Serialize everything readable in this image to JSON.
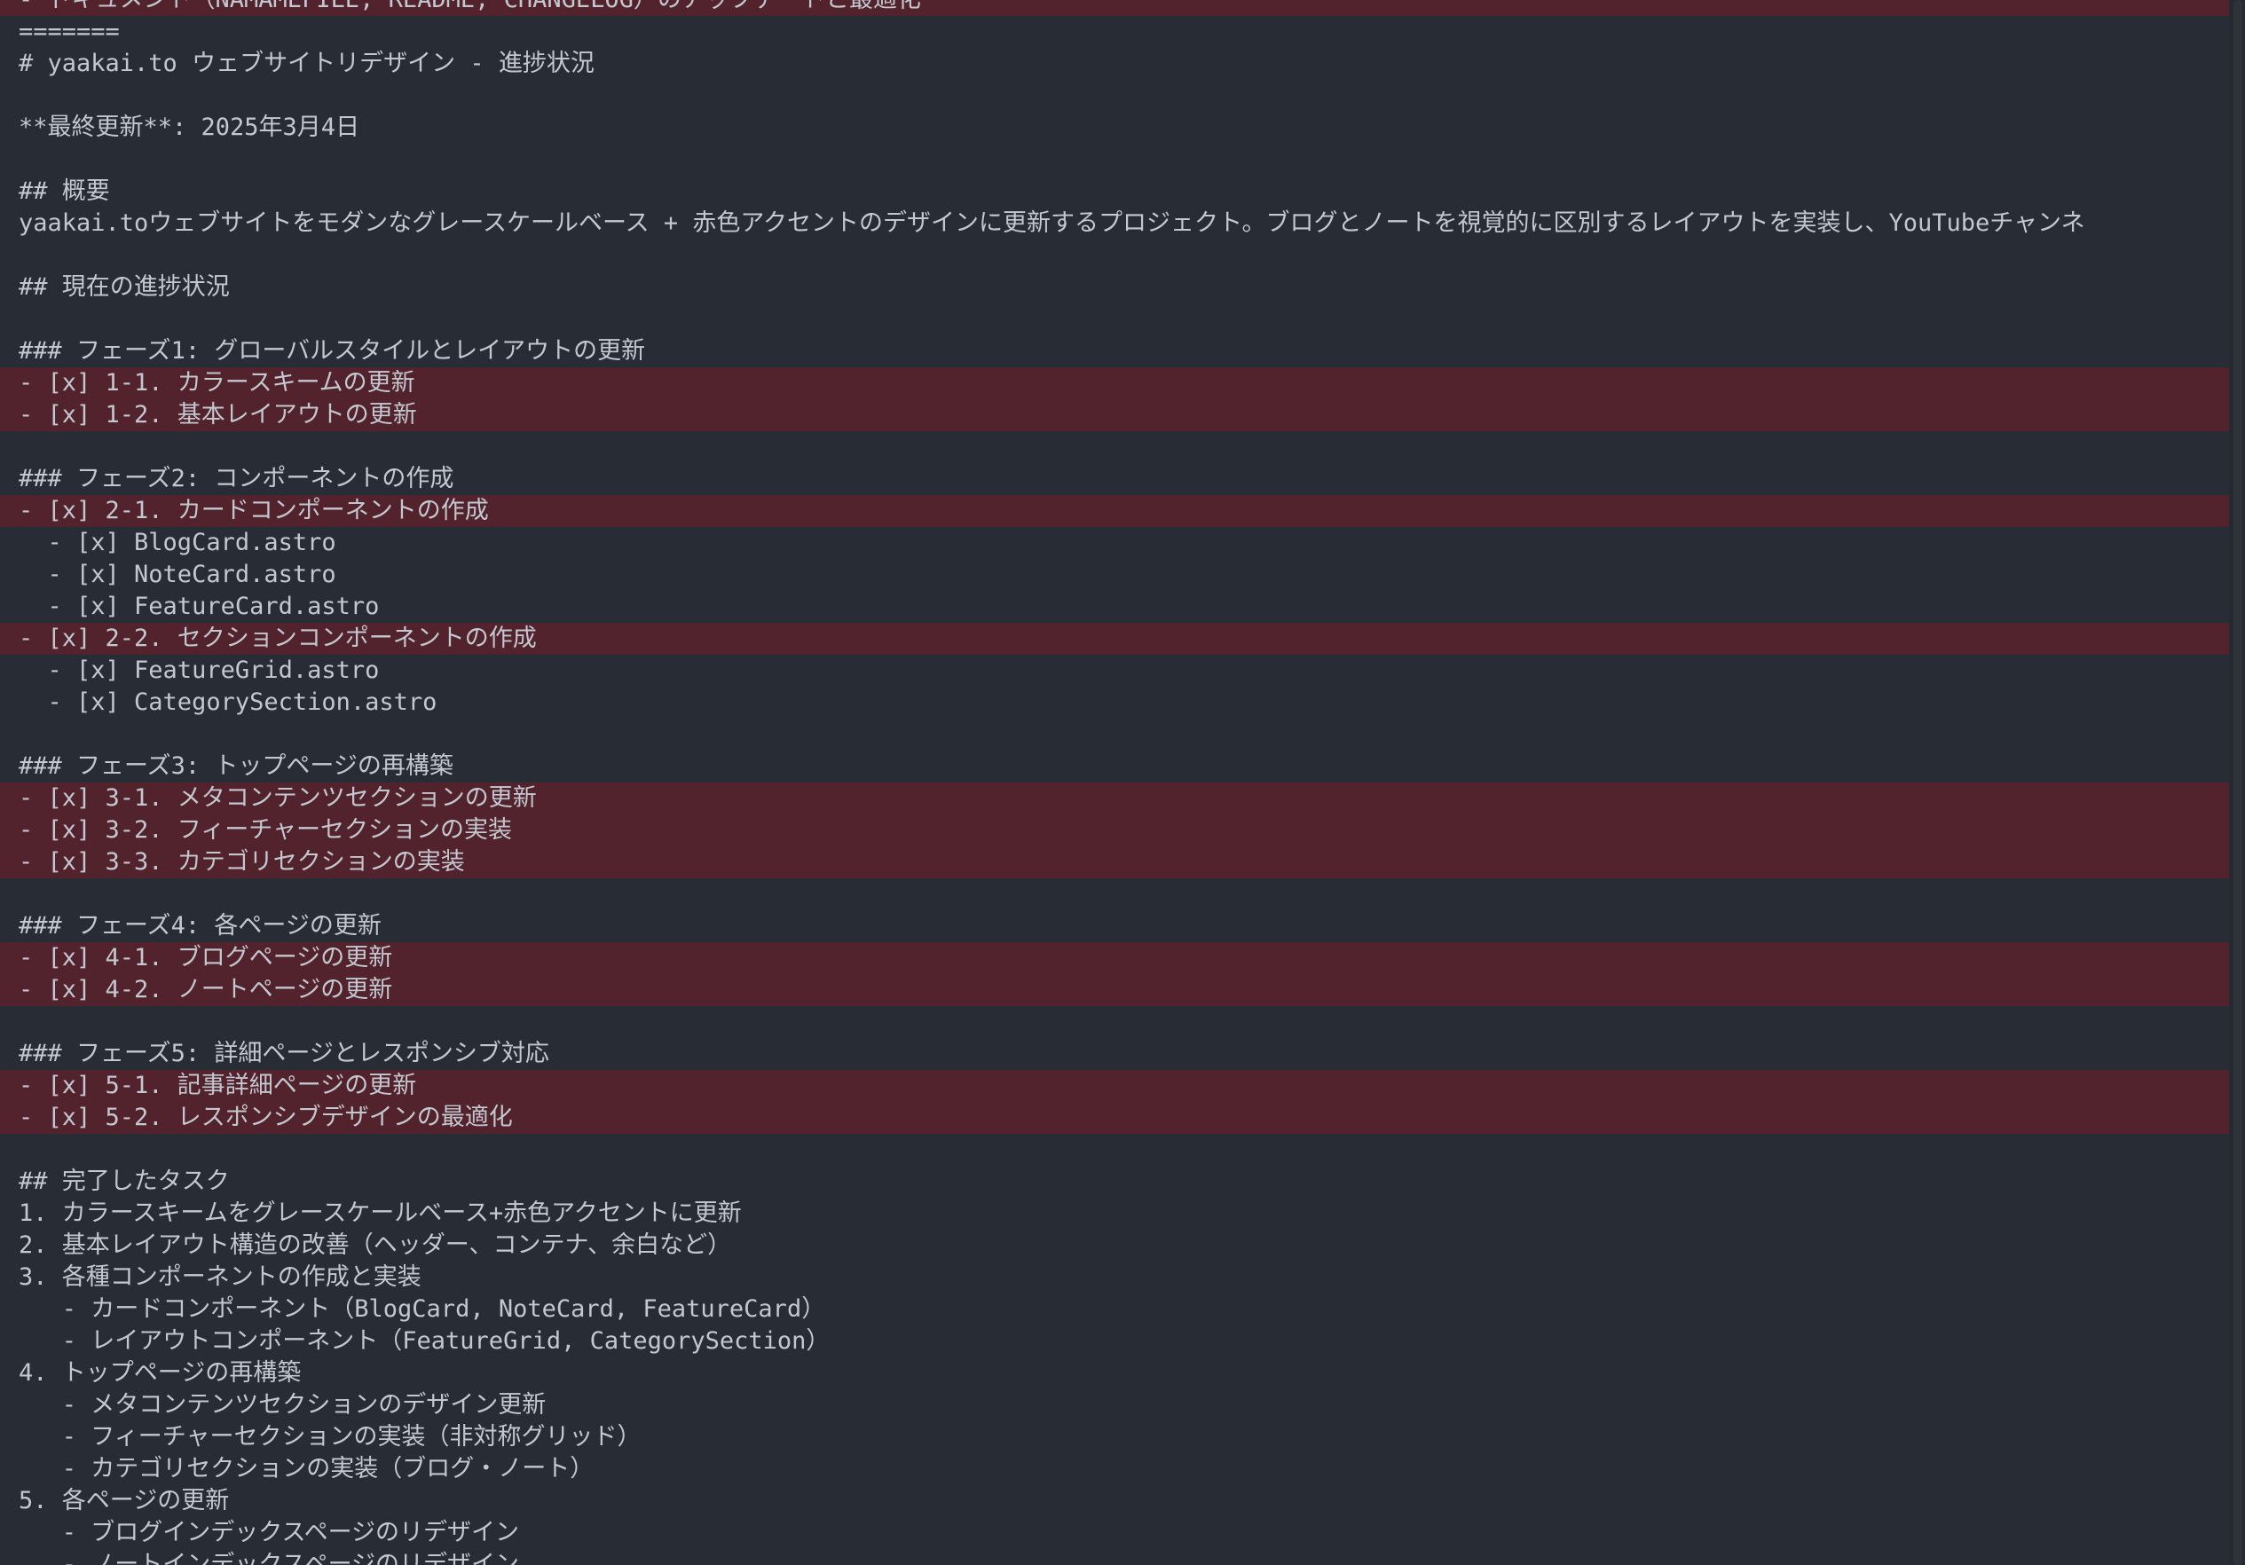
{
  "document": {
    "lines": [
      {
        "text": "- ドキュメント（NAMAMEFILE, README, CHANGELOG）のアップデートと最適化",
        "highlight": true
      },
      {
        "text": "=======",
        "highlight": false
      },
      {
        "text": "# yaakai.to ウェブサイトリデザイン - 進捗状況",
        "highlight": false
      },
      {
        "text": "",
        "highlight": false
      },
      {
        "text": "**最終更新**: 2025年3月4日",
        "highlight": false
      },
      {
        "text": "",
        "highlight": false
      },
      {
        "text": "## 概要",
        "highlight": false
      },
      {
        "text": "yaakai.toウェブサイトをモダンなグレースケールベース + 赤色アクセントのデザインに更新するプロジェクト。ブログとノートを視覚的に区別するレイアウトを実装し、YouTubeチャンネ",
        "highlight": false
      },
      {
        "text": "",
        "highlight": false
      },
      {
        "text": "## 現在の進捗状況",
        "highlight": false
      },
      {
        "text": "",
        "highlight": false
      },
      {
        "text": "### フェーズ1: グローバルスタイルとレイアウトの更新",
        "highlight": false
      },
      {
        "text": "- [x] 1-1. カラースキームの更新",
        "highlight": true
      },
      {
        "text": "- [x] 1-2. 基本レイアウトの更新",
        "highlight": true
      },
      {
        "text": "",
        "highlight": false
      },
      {
        "text": "### フェーズ2: コンポーネントの作成",
        "highlight": false
      },
      {
        "text": "- [x] 2-1. カードコンポーネントの作成",
        "highlight": true
      },
      {
        "text": "  - [x] BlogCard.astro",
        "highlight": false
      },
      {
        "text": "  - [x] NoteCard.astro",
        "highlight": false
      },
      {
        "text": "  - [x] FeatureCard.astro",
        "highlight": false
      },
      {
        "text": "- [x] 2-2. セクションコンポーネントの作成",
        "highlight": true
      },
      {
        "text": "  - [x] FeatureGrid.astro",
        "highlight": false
      },
      {
        "text": "  - [x] CategorySection.astro",
        "highlight": false
      },
      {
        "text": "",
        "highlight": false
      },
      {
        "text": "### フェーズ3: トップページの再構築",
        "highlight": false
      },
      {
        "text": "- [x] 3-1. メタコンテンツセクションの更新",
        "highlight": true
      },
      {
        "text": "- [x] 3-2. フィーチャーセクションの実装",
        "highlight": true
      },
      {
        "text": "- [x] 3-3. カテゴリセクションの実装",
        "highlight": true
      },
      {
        "text": "",
        "highlight": false
      },
      {
        "text": "### フェーズ4: 各ページの更新",
        "highlight": false
      },
      {
        "text": "- [x] 4-1. ブログページの更新",
        "highlight": true
      },
      {
        "text": "- [x] 4-2. ノートページの更新",
        "highlight": true
      },
      {
        "text": "",
        "highlight": false
      },
      {
        "text": "### フェーズ5: 詳細ページとレスポンシブ対応",
        "highlight": false
      },
      {
        "text": "- [x] 5-1. 記事詳細ページの更新",
        "highlight": true
      },
      {
        "text": "- [x] 5-2. レスポンシブデザインの最適化",
        "highlight": true
      },
      {
        "text": "",
        "highlight": false
      },
      {
        "text": "## 完了したタスク",
        "highlight": false
      },
      {
        "text": "1. カラースキームをグレースケールベース+赤色アクセントに更新",
        "highlight": false
      },
      {
        "text": "2. 基本レイアウト構造の改善（ヘッダー、コンテナ、余白など）",
        "highlight": false
      },
      {
        "text": "3. 各種コンポーネントの作成と実装",
        "highlight": false
      },
      {
        "text": "   - カードコンポーネント（BlogCard, NoteCard, FeatureCard）",
        "highlight": false
      },
      {
        "text": "   - レイアウトコンポーネント（FeatureGrid, CategorySection）",
        "highlight": false
      },
      {
        "text": "4. トップページの再構築",
        "highlight": false
      },
      {
        "text": "   - メタコンテンツセクションのデザイン更新",
        "highlight": false
      },
      {
        "text": "   - フィーチャーセクションの実装（非対称グリッド）",
        "highlight": false
      },
      {
        "text": "   - カテゴリセクションの実装（ブログ・ノート）",
        "highlight": false
      },
      {
        "text": "5. 各ページの更新",
        "highlight": false
      },
      {
        "text": "   - ブログインデックスページのリデザイン",
        "highlight": false
      },
      {
        "text": "   - ノートインデックスページのリデザイン",
        "highlight": false
      }
    ]
  }
}
